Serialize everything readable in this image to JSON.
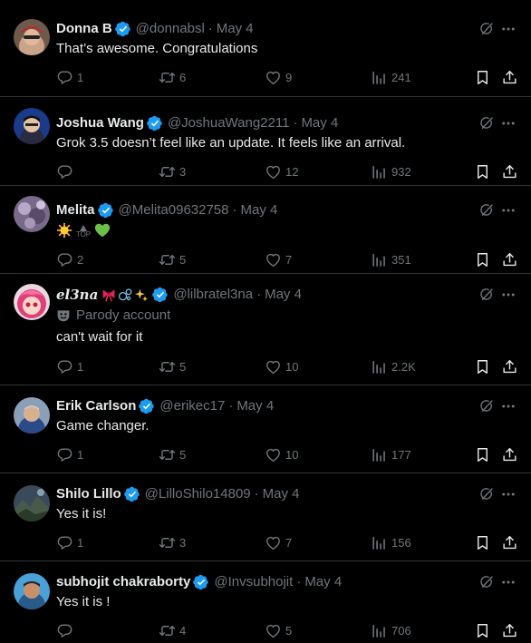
{
  "tweets": [
    {
      "name": "Donna B",
      "handle": "@donnabsl",
      "date": "May 4",
      "text": "That’s awesome. Congratulations",
      "replies": "1",
      "reposts": "6",
      "likes": "9",
      "views": "241"
    },
    {
      "name": "Joshua Wang",
      "handle": "@JoshuaWang2211",
      "date": "May 4",
      "text": "Grok 3.5 doesn’t feel like an update. It feels like an arrival.",
      "replies": "",
      "reposts": "3",
      "likes": "12",
      "views": "932"
    },
    {
      "name": "Melita",
      "handle": "@Melita09632758",
      "date": "May 4",
      "emoji_top_label": "TOP",
      "replies": "2",
      "reposts": "5",
      "likes": "7",
      "views": "351"
    },
    {
      "name": "el3na",
      "handle": "@lilbratel3na",
      "date": "May 4",
      "parody_label": "Parody account",
      "text": "can't wait for it",
      "replies": "1",
      "reposts": "5",
      "likes": "10",
      "views": "2.2K"
    },
    {
      "name": "Erik Carlson",
      "handle": "@erikec17",
      "date": "May 4",
      "text": "Game changer.",
      "replies": "1",
      "reposts": "5",
      "likes": "10",
      "views": "177"
    },
    {
      "name": "Shilo Lillo",
      "handle": "@LilloShilo14809",
      "date": "May 4",
      "text": "Yes it is!",
      "replies": "1",
      "reposts": "3",
      "likes": "7",
      "views": "156"
    },
    {
      "name": "subhojit chakraborty",
      "handle": "@Invsubhojit",
      "date": "May 4",
      "text": "Yes it is !",
      "replies": "",
      "reposts": "4",
      "likes": "5",
      "views": "706"
    }
  ],
  "colors": {
    "background": "#000000",
    "text": "#e7e9ea",
    "muted": "#71767b",
    "verified": "#1d9bf0",
    "border": "#2f3336"
  }
}
